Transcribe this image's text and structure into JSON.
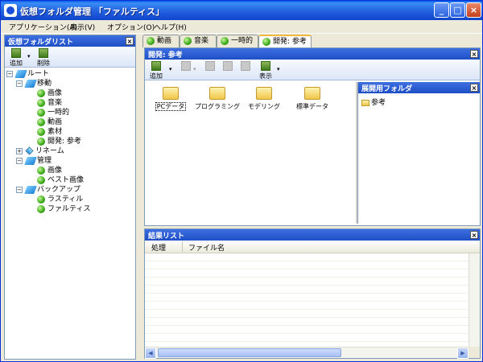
{
  "window": {
    "title": "仮想フォルダ管理 「ファルティス」"
  },
  "menubar": {
    "items": [
      "アプリケーション(A)",
      "表示(V)",
      "オプション(O)",
      "ヘルプ(H)"
    ]
  },
  "left_pane": {
    "title": "仮想フォルダリスト",
    "toolbar": {
      "add": "追加",
      "delete": "削除"
    },
    "tree": {
      "root": "ルート",
      "move": "移動",
      "move_children": [
        "画像",
        "音楽",
        "一時的",
        "動画",
        "素材",
        "開発: 参考"
      ],
      "rename": "リネーム",
      "manage": "管理",
      "manage_children": [
        "画像",
        "ベスト画像"
      ],
      "backup": "バックアップ",
      "backup_children": [
        "ラスティル",
        "ファルティス"
      ]
    }
  },
  "tabs": [
    {
      "label": "動画",
      "active": false
    },
    {
      "label": "音楽",
      "active": false
    },
    {
      "label": "一時的",
      "active": false
    },
    {
      "label": "開発: 参考",
      "active": true
    }
  ],
  "main_pane": {
    "title": "開発: 参考",
    "toolbar": {
      "add": "追加",
      "view": "表示"
    },
    "files": [
      "PCデータ",
      "プログラミング",
      "モデリング",
      "標準データ"
    ]
  },
  "sub_pane": {
    "title": "展開用フォルダ",
    "items": [
      "参考"
    ]
  },
  "result_pane": {
    "title": "結果リスト",
    "columns": [
      "処理",
      "ファイル名"
    ]
  },
  "colors": {
    "title_bar": "#2769e3",
    "pane_header": "#1f4fc6",
    "accent": "#3aa816"
  }
}
